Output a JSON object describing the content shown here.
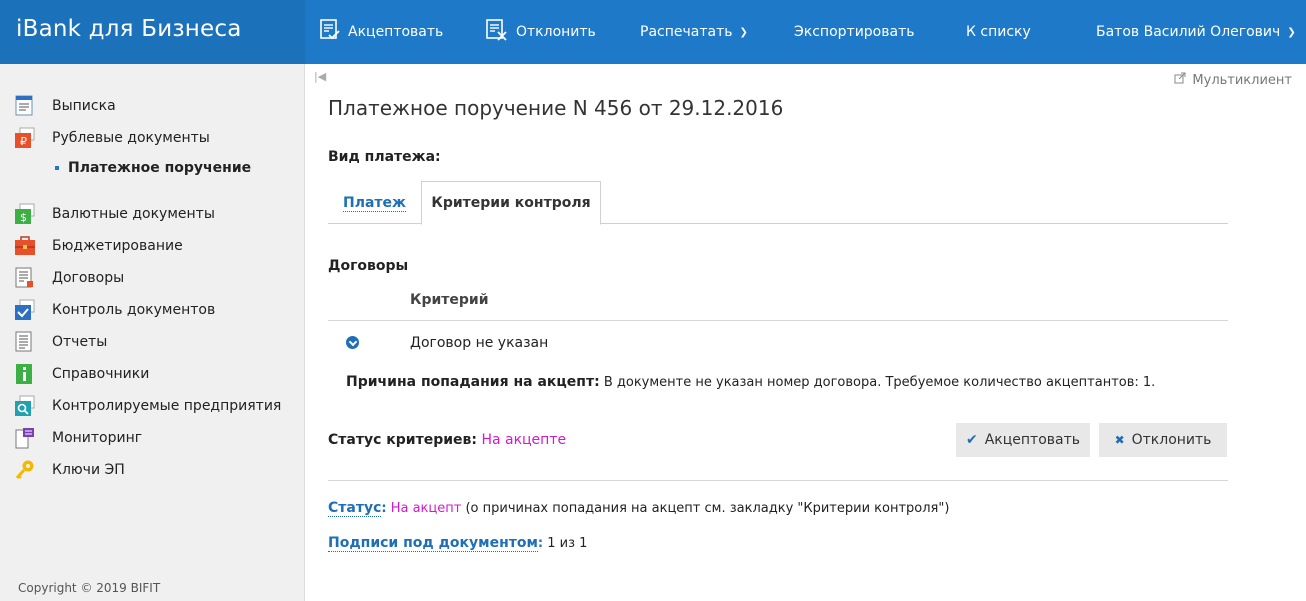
{
  "app": {
    "brand": "iBank для Бизнеса"
  },
  "topnav": {
    "accept": "Акцептовать",
    "reject": "Отклонить",
    "print": "Распечатать",
    "export": "Экспортировать",
    "to_list": "К списку",
    "user": "Батов Василий Олегович"
  },
  "sidebar": {
    "items": [
      {
        "label": "Выписка",
        "icon": "statement-icon"
      },
      {
        "label": "Рублевые документы",
        "icon": "ruble-docs-icon"
      },
      {
        "label": "Валютные документы",
        "icon": "currency-docs-icon"
      },
      {
        "label": "Бюджетирование",
        "icon": "budget-icon"
      },
      {
        "label": "Договоры",
        "icon": "contracts-icon"
      },
      {
        "label": "Контроль документов",
        "icon": "doc-control-icon"
      },
      {
        "label": "Отчеты",
        "icon": "reports-icon"
      },
      {
        "label": "Справочники",
        "icon": "reference-icon"
      },
      {
        "label": "Контролируемые предприятия",
        "icon": "controlled-companies-icon"
      },
      {
        "label": "Мониторинг",
        "icon": "monitoring-icon"
      },
      {
        "label": "Ключи ЭП",
        "icon": "key-icon"
      }
    ],
    "active_sub": "Платежное поручение",
    "copyright": "Copyright © 2019 BIFIT"
  },
  "main": {
    "multi_client": "Мультиклиент",
    "title": "Платежное поручение N 456 от 29.12.2016",
    "payment_type_label": "Вид платежа:",
    "tabs": [
      {
        "label": "Платеж"
      },
      {
        "label": "Критерии контроля"
      }
    ],
    "section_title": "Договоры",
    "criteria_header": "Критерий",
    "criterion": "Договор не указан",
    "reason_label": "Причина попадания на акцепт:",
    "reason_text": " В документе не указан номер договора. Требуемое количество акцептантов: 1.",
    "criteria_status_label": "Статус критериев:",
    "criteria_status_value": "На акцепте",
    "accept_button": "Акцептовать",
    "reject_button": "Отклонить",
    "status_label": "Статус",
    "status_value": "На акцепт",
    "status_note": " (о причинах попадания на акцепт см. закладку \"Критерии контроля\")",
    "signatures_label": "Подписи под документом",
    "signatures_value": " 1 из 1"
  },
  "colors": {
    "header_blue": "#1e7ac8",
    "brand_blue": "#1c71bb",
    "link_blue": "#1e6fb8",
    "status_magenta": "#d219d2"
  }
}
